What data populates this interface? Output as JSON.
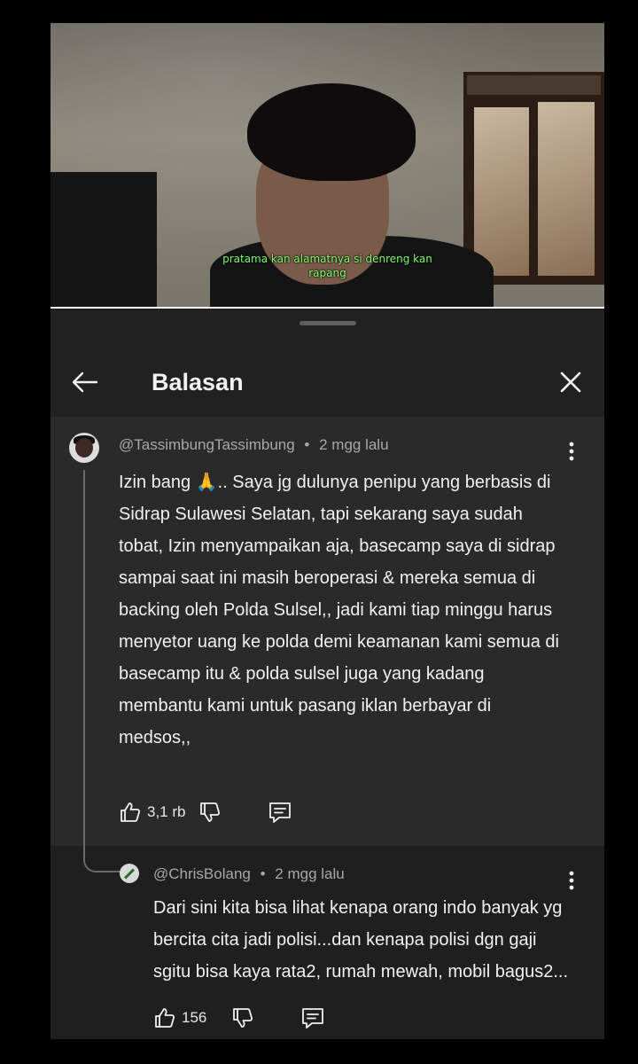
{
  "video": {
    "subtitle_line1": "pratama kan alamatnya si denreng kan",
    "subtitle_line2": "rapang",
    "progress_fraction": 1.0
  },
  "panel": {
    "title": "Balasan",
    "back_icon": "arrow-left-icon",
    "close_icon": "close-icon"
  },
  "comment": {
    "author": "@TassimbungTassimbung",
    "time": "2 mgg lalu",
    "text": "Izin bang 🙏.. Saya jg dulunya penipu yang berbasis di Sidrap Sulawesi Selatan, tapi sekarang saya sudah tobat, Izin menyampaikan aja, basecamp saya di sidrap sampai saat ini masih beroperasi & mereka semua di backing oleh Polda Sulsel,, jadi kami tiap minggu harus menyetor uang ke polda demi keamanan kami semua di basecamp itu & polda sulsel juga yang kadang membantu kami untuk pasang iklan berbayar di medsos,,",
    "likes": "3,1 rb"
  },
  "reply": {
    "author": "@ChrisBolang",
    "time": "2 mgg lalu",
    "text": "Dari sini kita bisa lihat kenapa orang indo banyak yg bercita cita jadi polisi...dan kenapa polisi dgn gaji sgitu bisa kaya rata2, rumah mewah, mobil bagus2...",
    "likes": "156"
  },
  "separator": "•"
}
